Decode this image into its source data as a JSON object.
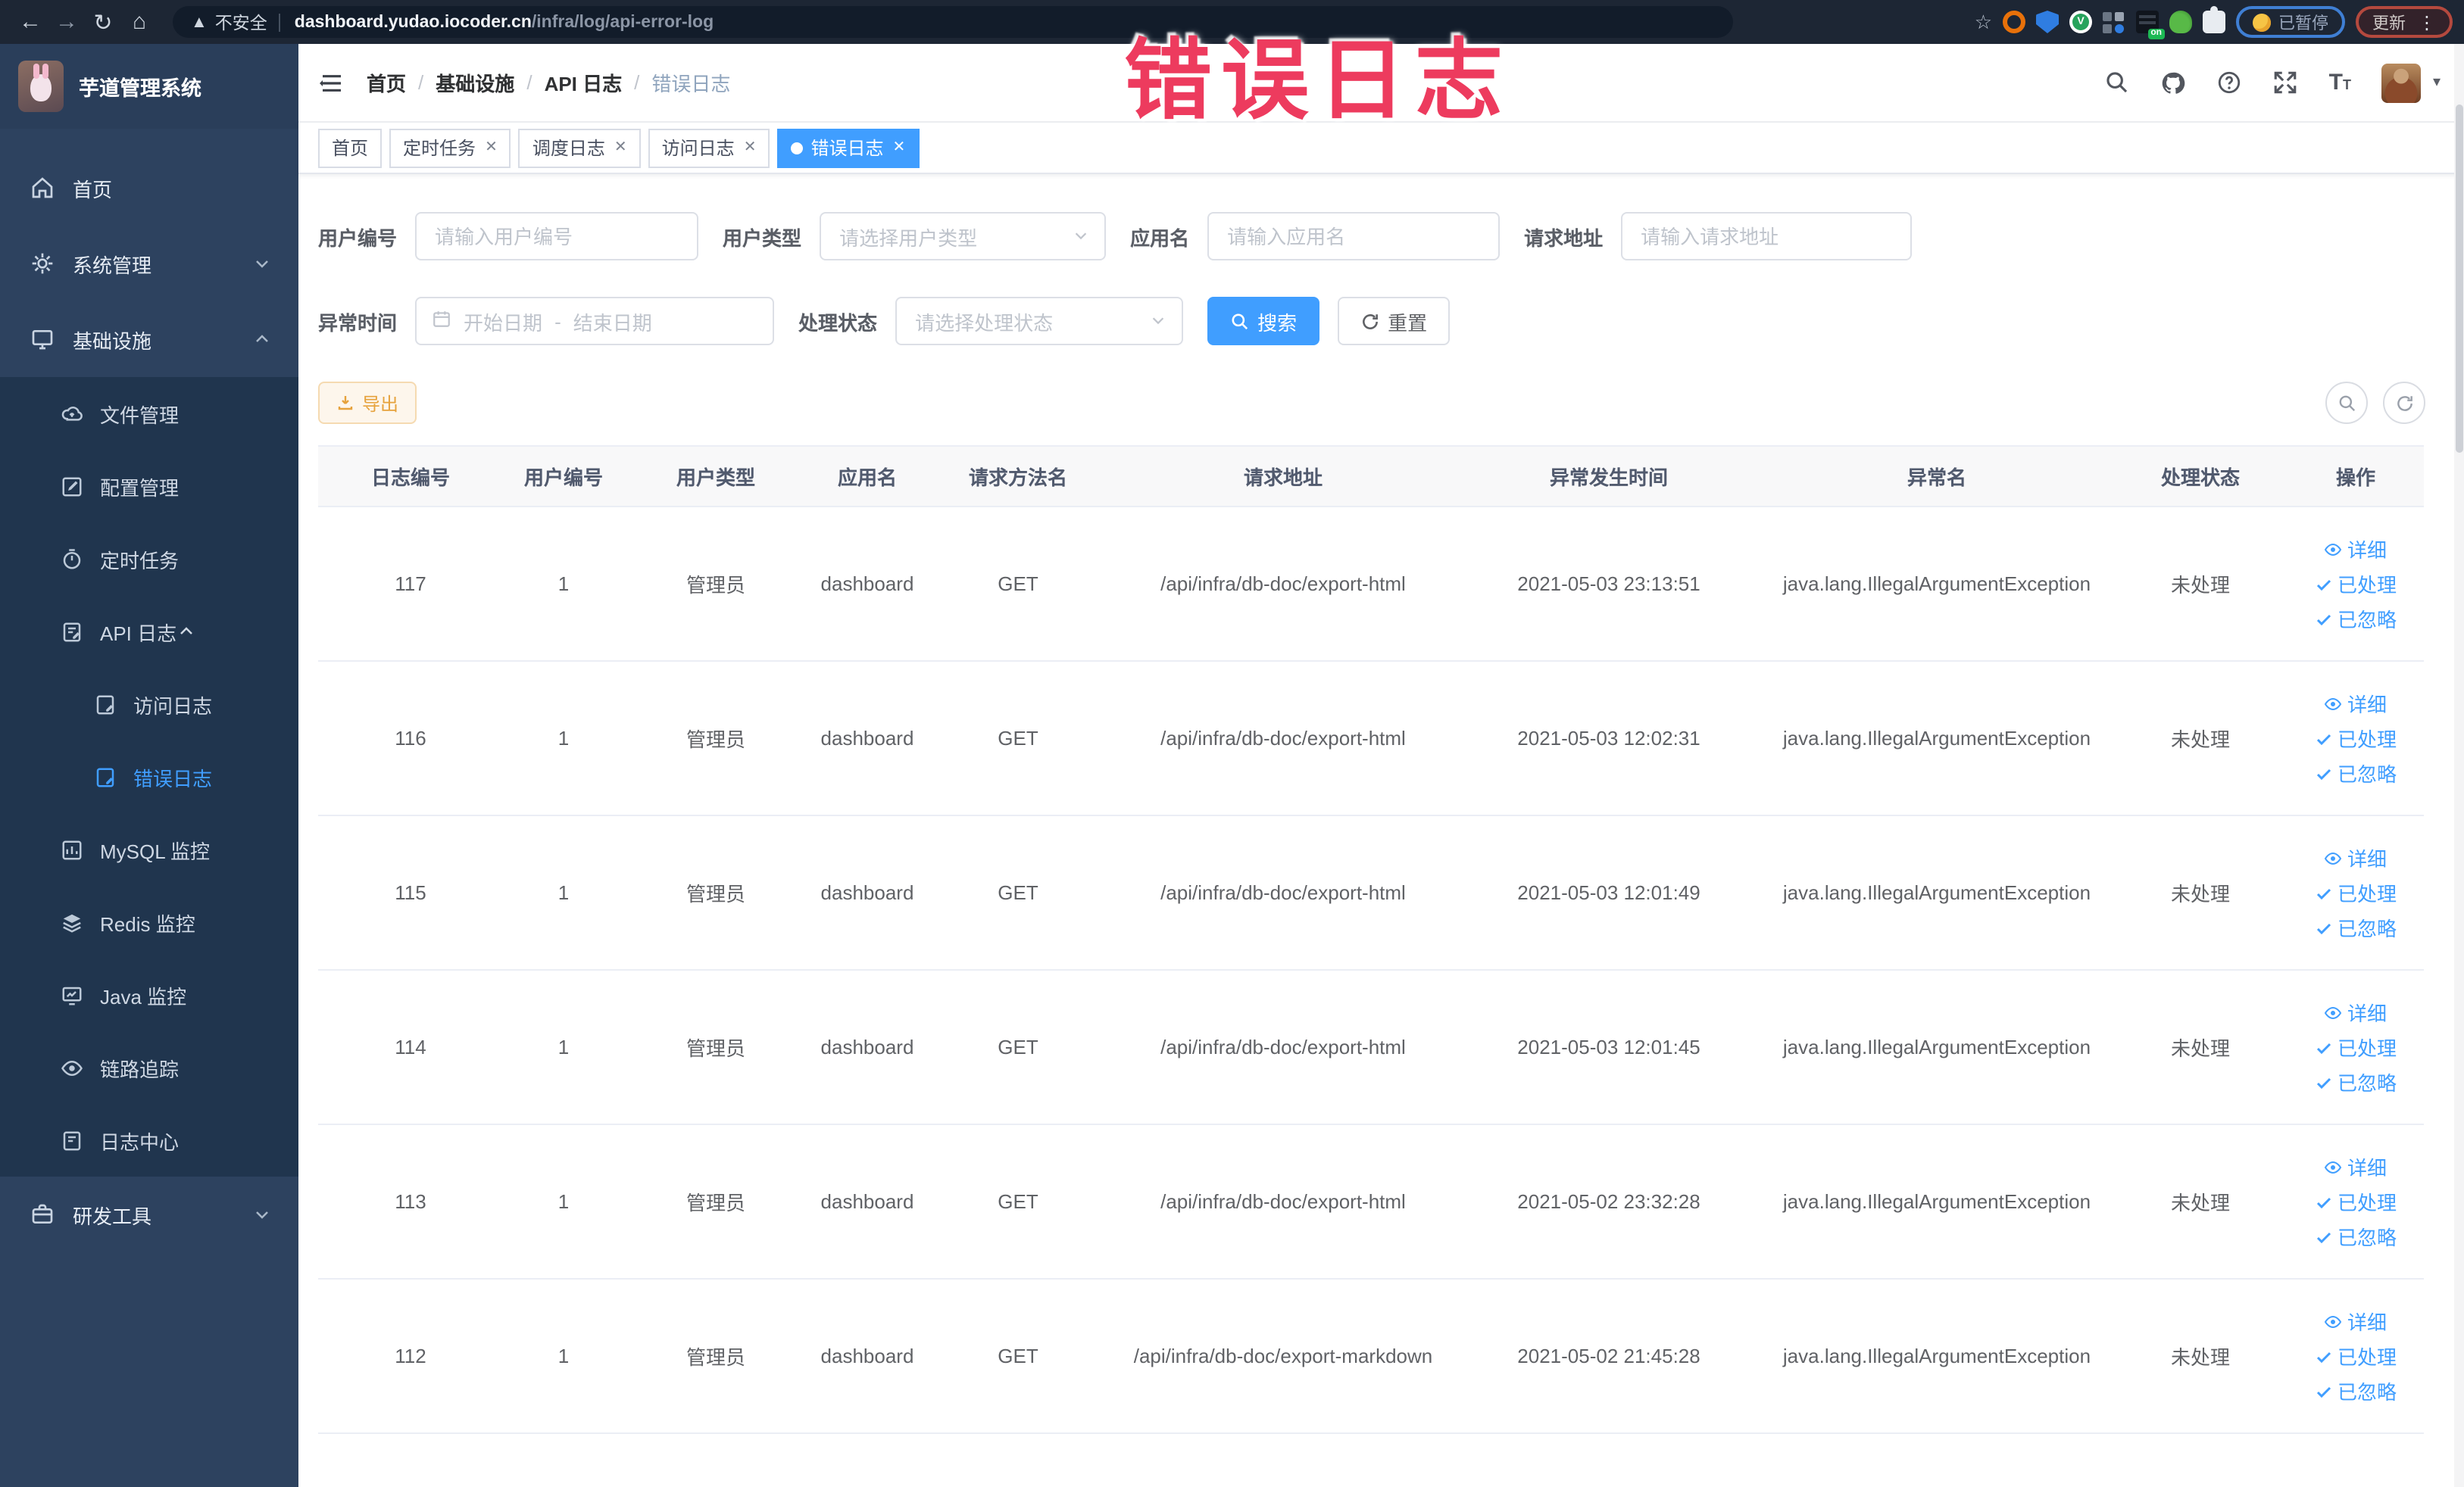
{
  "browser": {
    "security_label": "不安全",
    "url_host": "dashboard.yudao.iocoder.cn",
    "url_path": "/infra/log/api-error-log",
    "on_badge": "on",
    "paused_badge": "已暂停",
    "update_badge": "更新"
  },
  "overlay_title": "错误日志",
  "sidebar": {
    "app_title": "芋道管理系统",
    "items": [
      {
        "label": "首页"
      },
      {
        "label": "系统管理"
      },
      {
        "label": "基础设施"
      },
      {
        "label": "文件管理"
      },
      {
        "label": "配置管理"
      },
      {
        "label": "定时任务"
      },
      {
        "label": "API 日志"
      },
      {
        "label": "访问日志"
      },
      {
        "label": "错误日志"
      },
      {
        "label": "MySQL 监控"
      },
      {
        "label": "Redis 监控"
      },
      {
        "label": "Java 监控"
      },
      {
        "label": "链路追踪"
      },
      {
        "label": "日志中心"
      },
      {
        "label": "研发工具"
      }
    ]
  },
  "header": {
    "breadcrumb": [
      "首页",
      "基础设施",
      "API 日志",
      "错误日志"
    ],
    "separator": "/"
  },
  "tabs": [
    {
      "label": "首页"
    },
    {
      "label": "定时任务"
    },
    {
      "label": "调度日志"
    },
    {
      "label": "访问日志"
    },
    {
      "label": "错误日志"
    }
  ],
  "filters": {
    "user_id": {
      "label": "用户编号",
      "placeholder": "请输入用户编号"
    },
    "user_type": {
      "label": "用户类型",
      "placeholder": "请选择用户类型"
    },
    "app_name": {
      "label": "应用名",
      "placeholder": "请输入应用名"
    },
    "request_url": {
      "label": "请求地址",
      "placeholder": "请输入请求地址"
    },
    "exception_time": {
      "label": "异常时间",
      "start_placeholder": "开始日期",
      "range_separator": "-",
      "end_placeholder": "结束日期"
    },
    "process_status": {
      "label": "处理状态",
      "placeholder": "请选择处理状态"
    },
    "search_label": "搜索",
    "reset_label": "重置"
  },
  "toolbar": {
    "export_label": "导出"
  },
  "table": {
    "columns": [
      "日志编号",
      "用户编号",
      "用户类型",
      "应用名",
      "请求方法名",
      "请求地址",
      "异常发生时间",
      "异常名",
      "处理状态",
      "操作"
    ],
    "actions": [
      "详细",
      "已处理",
      "已忽略"
    ],
    "rows": [
      {
        "id": "117",
        "user_id": "1",
        "user_type": "管理员",
        "app": "dashboard",
        "method": "GET",
        "url": "/api/infra/db-doc/export-html",
        "time": "2021-05-03 23:13:51",
        "exception": "java.lang.IllegalArgumentException",
        "status": "未处理"
      },
      {
        "id": "116",
        "user_id": "1",
        "user_type": "管理员",
        "app": "dashboard",
        "method": "GET",
        "url": "/api/infra/db-doc/export-html",
        "time": "2021-05-03 12:02:31",
        "exception": "java.lang.IllegalArgumentException",
        "status": "未处理"
      },
      {
        "id": "115",
        "user_id": "1",
        "user_type": "管理员",
        "app": "dashboard",
        "method": "GET",
        "url": "/api/infra/db-doc/export-html",
        "time": "2021-05-03 12:01:49",
        "exception": "java.lang.IllegalArgumentException",
        "status": "未处理"
      },
      {
        "id": "114",
        "user_id": "1",
        "user_type": "管理员",
        "app": "dashboard",
        "method": "GET",
        "url": "/api/infra/db-doc/export-html",
        "time": "2021-05-03 12:01:45",
        "exception": "java.lang.IllegalArgumentException",
        "status": "未处理"
      },
      {
        "id": "113",
        "user_id": "1",
        "user_type": "管理员",
        "app": "dashboard",
        "method": "GET",
        "url": "/api/infra/db-doc/export-html",
        "time": "2021-05-02 23:32:28",
        "exception": "java.lang.IllegalArgumentException",
        "status": "未处理"
      },
      {
        "id": "112",
        "user_id": "1",
        "user_type": "管理员",
        "app": "dashboard",
        "method": "GET",
        "url": "/api/infra/db-doc/export-markdown",
        "time": "2021-05-02 21:45:28",
        "exception": "java.lang.IllegalArgumentException",
        "status": "未处理"
      }
    ]
  },
  "colors": {
    "accent": "#409eff",
    "overlay_annotation": "#ed3b5e",
    "warning": "#e6a23c",
    "sidebar_bg": "#2d425f",
    "submenu_bg": "#20354e"
  }
}
